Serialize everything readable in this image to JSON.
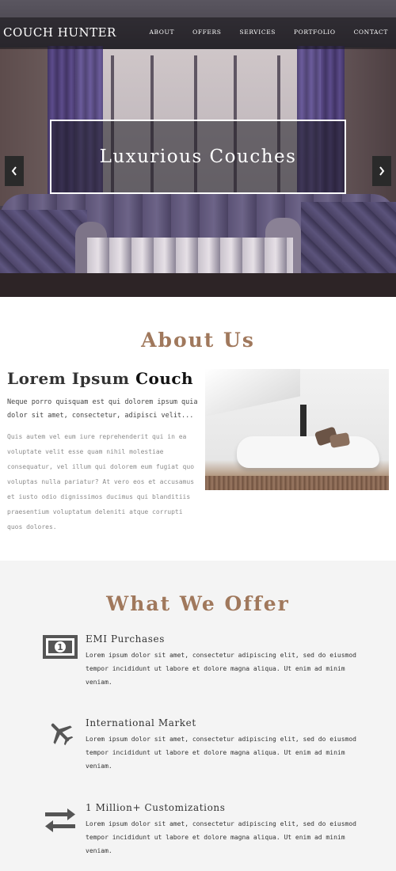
{
  "header": {
    "logo": "COUCH HUNTER",
    "nav": [
      "ABOUT",
      "OFFERS",
      "SERVICES",
      "PORTFOLIO",
      "CONTACT"
    ]
  },
  "hero": {
    "caption": "Luxurious Couches",
    "prev_icon": "chevron-left-icon",
    "next_icon": "chevron-right-icon"
  },
  "about": {
    "title": "About Us",
    "heading_plain": "Lorem Ipsum",
    "heading_accent": "Couch",
    "lead": "Neque porro quisquam est qui dolorem ipsum quia dolor sit amet, consectetur, adipisci velit...",
    "body": "Quis autem vel eum iure reprehenderit qui in ea voluptate velit esse quam nihil molestiae consequatur, vel illum qui dolorem eum fugiat quo voluptas nulla pariatur? At vero eos et accusamus et iusto odio dignissimos ducimus qui blanditiis praesentium voluptatum deleniti atque corrupti quos dolores."
  },
  "offer": {
    "title": "What We Offer",
    "items": [
      {
        "icon": "money-icon",
        "title": "EMI Purchases",
        "text": "Lorem ipsum dolor sit amet, consectetur adipiscing elit, sed do eiusmod tempor incididunt ut labore et dolore magna aliqua. Ut enim ad minim veniam."
      },
      {
        "icon": "airplane-icon",
        "title": "International Market",
        "text": "Lorem ipsum dolor sit amet, consectetur adipiscing elit, sed do eiusmod tempor incididunt ut labore et dolore magna aliqua. Ut enim ad minim veniam."
      },
      {
        "icon": "exchange-arrows-icon",
        "title": "1 Million+ Customizations",
        "text": "Lorem ipsum dolor sit amet, consectetur adipiscing elit, sed do eiusmod tempor incididunt ut labore et dolore magna aliqua. Ut enim ad minim veniam."
      }
    ]
  },
  "colors": {
    "accent": "#a0785c",
    "icon": "#555555",
    "offer_bg": "#f4f4f4"
  }
}
